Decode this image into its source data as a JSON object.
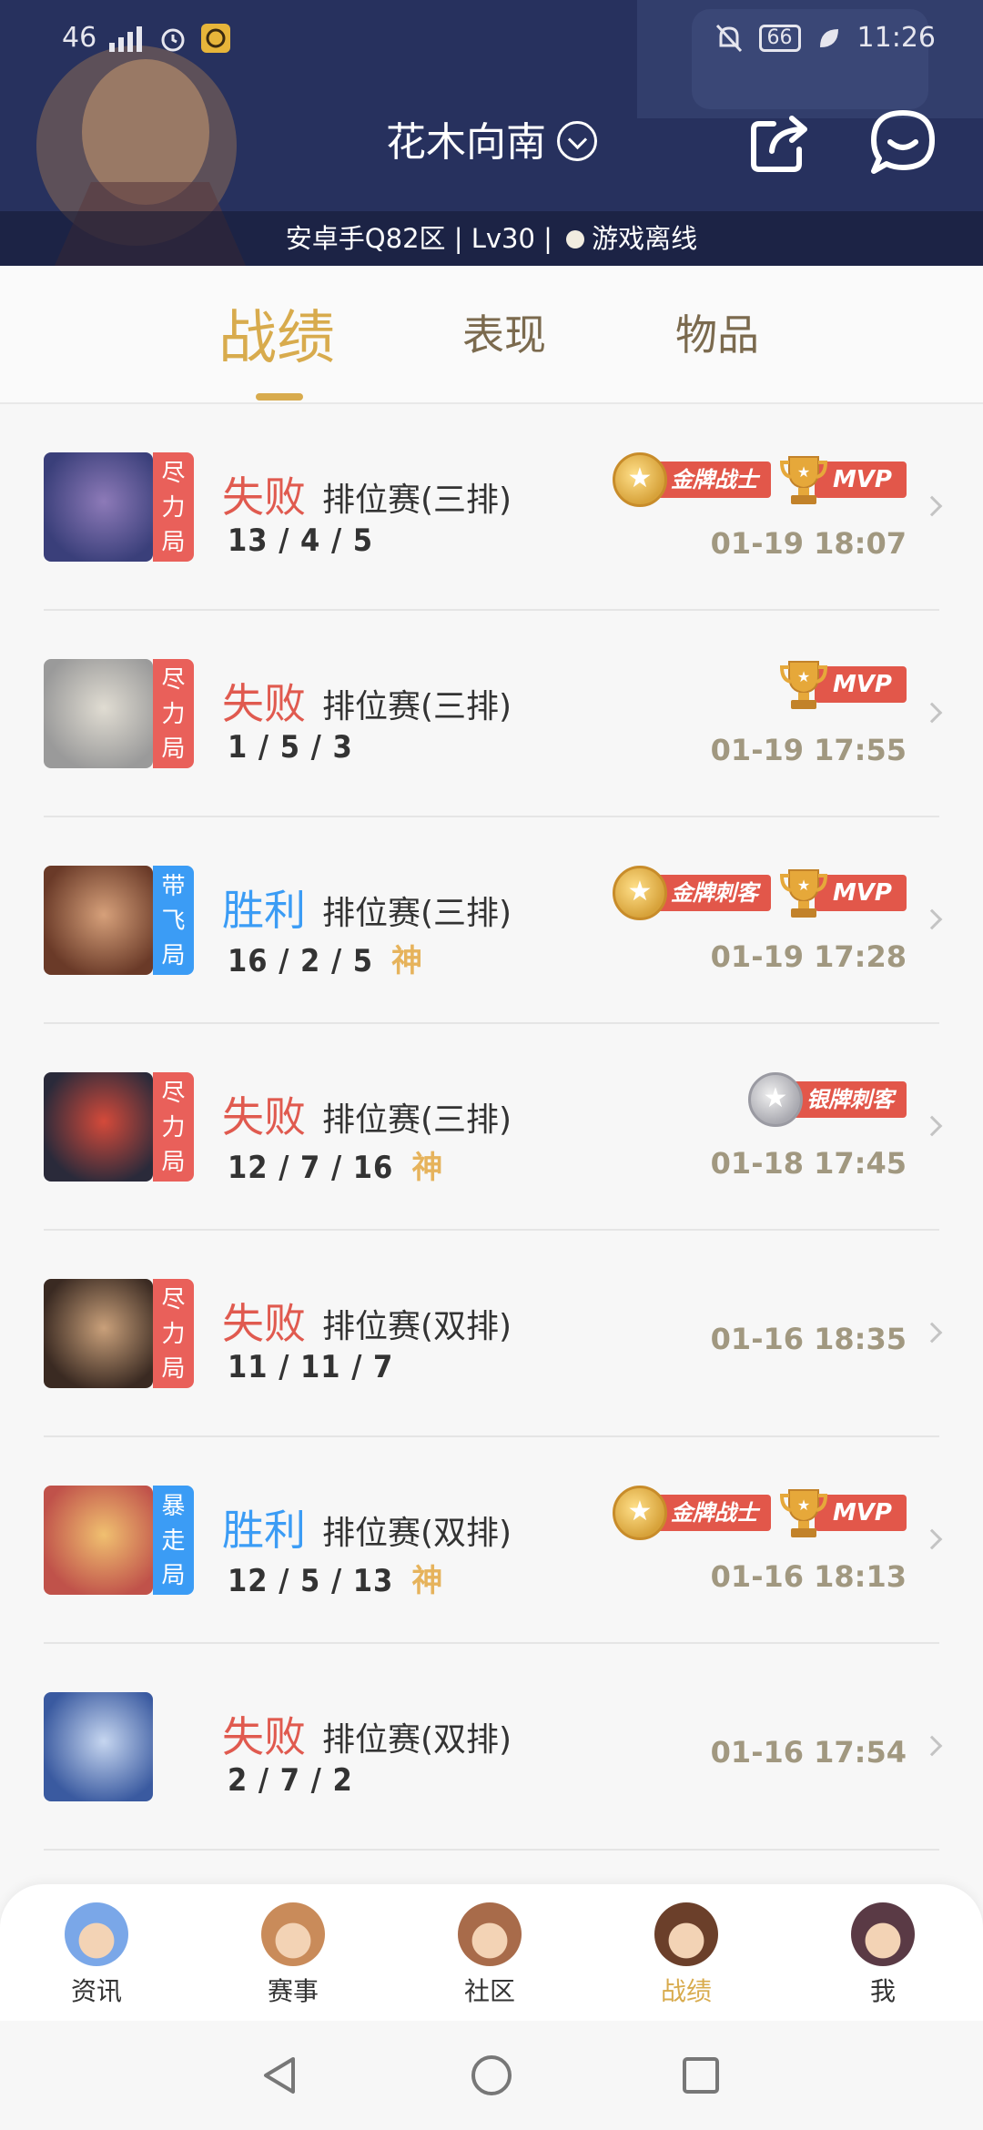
{
  "status_bar": {
    "network": "46",
    "battery": "66",
    "time": "11:26"
  },
  "header": {
    "username": "花木向南",
    "info": "安卓手Q82区 | Lv30 | ",
    "status_text": "游戏离线"
  },
  "tabs": [
    {
      "label": "战绩",
      "active": true
    },
    {
      "label": "表现",
      "active": false
    },
    {
      "label": "物品",
      "active": false
    }
  ],
  "matches": [
    {
      "badge": "尽力局",
      "badge_color": "red",
      "result": "失败",
      "result_type": "lose",
      "mode": "排位赛(三排)",
      "kda": "13 / 4 / 5",
      "god": "",
      "medal": "金牌战士",
      "medal_type": "gold",
      "mvp": "MVP",
      "time": "01-19 18:07"
    },
    {
      "badge": "尽力局",
      "badge_color": "red",
      "result": "失败",
      "result_type": "lose",
      "mode": "排位赛(三排)",
      "kda": "1 / 5 / 3",
      "god": "",
      "medal": "",
      "medal_type": "",
      "mvp": "MVP",
      "time": "01-19 17:55"
    },
    {
      "badge": "带飞局",
      "badge_color": "blue",
      "result": "胜利",
      "result_type": "win",
      "mode": "排位赛(三排)",
      "kda": "16 / 2 / 5",
      "god": "神",
      "medal": "金牌刺客",
      "medal_type": "gold",
      "mvp": "MVP",
      "time": "01-19 17:28"
    },
    {
      "badge": "尽力局",
      "badge_color": "red",
      "result": "失败",
      "result_type": "lose",
      "mode": "排位赛(三排)",
      "kda": "12 / 7 / 16",
      "god": "神",
      "medal": "银牌刺客",
      "medal_type": "silver",
      "mvp": "",
      "time": "01-18 17:45"
    },
    {
      "badge": "尽力局",
      "badge_color": "red",
      "result": "失败",
      "result_type": "lose",
      "mode": "排位赛(双排)",
      "kda": "11 / 11 / 7",
      "god": "",
      "medal": "",
      "medal_type": "",
      "mvp": "",
      "time": "01-16 18:35"
    },
    {
      "badge": "暴走局",
      "badge_color": "blue",
      "result": "胜利",
      "result_type": "win",
      "mode": "排位赛(双排)",
      "kda": "12 / 5 / 13",
      "god": "神",
      "medal": "金牌战士",
      "medal_type": "gold",
      "mvp": "MVP",
      "time": "01-16 18:13"
    },
    {
      "badge": "",
      "badge_color": "",
      "result": "失败",
      "result_type": "lose",
      "mode": "排位赛(双排)",
      "kda": "2 / 7 / 2",
      "god": "",
      "medal": "",
      "medal_type": "",
      "mvp": "",
      "time": "01-16 17:54"
    }
  ],
  "bottom_nav": [
    {
      "label": "资讯",
      "active": false,
      "color": "#7aa7e8"
    },
    {
      "label": "赛事",
      "active": false,
      "color": "#c98b5a"
    },
    {
      "label": "社区",
      "active": false,
      "color": "#a86b4a"
    },
    {
      "label": "战绩",
      "active": true,
      "color": "#6b3f2a"
    },
    {
      "label": "我",
      "active": false,
      "color": "#5a3a45"
    }
  ],
  "colors": {
    "accent": "#d8ab4d",
    "lose": "#e05a4f",
    "win": "#3b9cf5"
  }
}
